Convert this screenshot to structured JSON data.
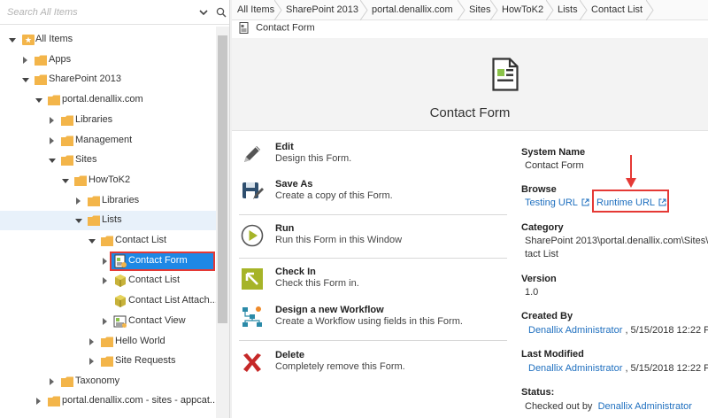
{
  "search": {
    "placeholder": "Search All Items"
  },
  "tree": {
    "nodes": [
      {
        "label": "All Items"
      },
      {
        "label": "Apps"
      },
      {
        "label": "SharePoint 2013"
      },
      {
        "label": "portal.denallix.com"
      },
      {
        "label": "Libraries"
      },
      {
        "label": "Management"
      },
      {
        "label": "Sites"
      },
      {
        "label": "HowToK2"
      },
      {
        "label": "Libraries"
      },
      {
        "label": "Lists"
      },
      {
        "label": "Contact List"
      },
      {
        "label": "Contact Form"
      },
      {
        "label": "Contact List"
      },
      {
        "label": "Contact List Attach..."
      },
      {
        "label": "Contact View"
      },
      {
        "label": "Hello World"
      },
      {
        "label": "Site Requests"
      },
      {
        "label": "Taxonomy"
      },
      {
        "label": "portal.denallix.com - sites - appcat..."
      }
    ]
  },
  "breadcrumb": {
    "items": [
      "All Items",
      "SharePoint 2013",
      "portal.denallix.com",
      "Sites",
      "HowToK2",
      "Lists",
      "Contact List"
    ],
    "current": "Contact Form"
  },
  "hero": {
    "title": "Contact Form"
  },
  "actions": [
    {
      "title": "Edit",
      "desc": "Design this Form.",
      "icon": "pencil-icon"
    },
    {
      "title": "Save As",
      "desc": "Create a copy of this Form.",
      "icon": "save-as-icon"
    },
    {
      "title": "Run",
      "desc": "Run this Form in this Window",
      "icon": "run-icon"
    },
    {
      "title": "Check In",
      "desc": "Check this Form in.",
      "icon": "check-in-icon"
    },
    {
      "title": "Design a new Workflow",
      "desc": "Create a Workflow using fields in this Form.",
      "icon": "workflow-icon"
    },
    {
      "title": "Delete",
      "desc": "Completely remove this Form.",
      "icon": "delete-icon"
    }
  ],
  "properties": {
    "system_name_label": "System Name",
    "system_name": "Contact Form",
    "browse_label": "Browse",
    "testing_url": "Testing URL",
    "runtime_url": "Runtime URL",
    "category_label": "Category",
    "category_line1": "SharePoint 2013\\portal.denallix.com\\Sites\\Ho",
    "category_line2": "tact List",
    "version_label": "Version",
    "version": "1.0",
    "created_by_label": "Created By",
    "created_by": "Denallix Administrator",
    "created_on": ", 5/15/2018 12:22 P",
    "last_modified_label": "Last Modified",
    "modified_by": "Denallix Administrator",
    "modified_on": ", 5/15/2018 12:22 P",
    "status_label": "Status:",
    "status_prefix": "Checked out by",
    "status_user": "Denallix Administrator"
  },
  "colors": {
    "accent": "#1e88e5",
    "link": "#1e6fbf",
    "highlight_box": "#e53935",
    "folder": "#f3b54a"
  }
}
